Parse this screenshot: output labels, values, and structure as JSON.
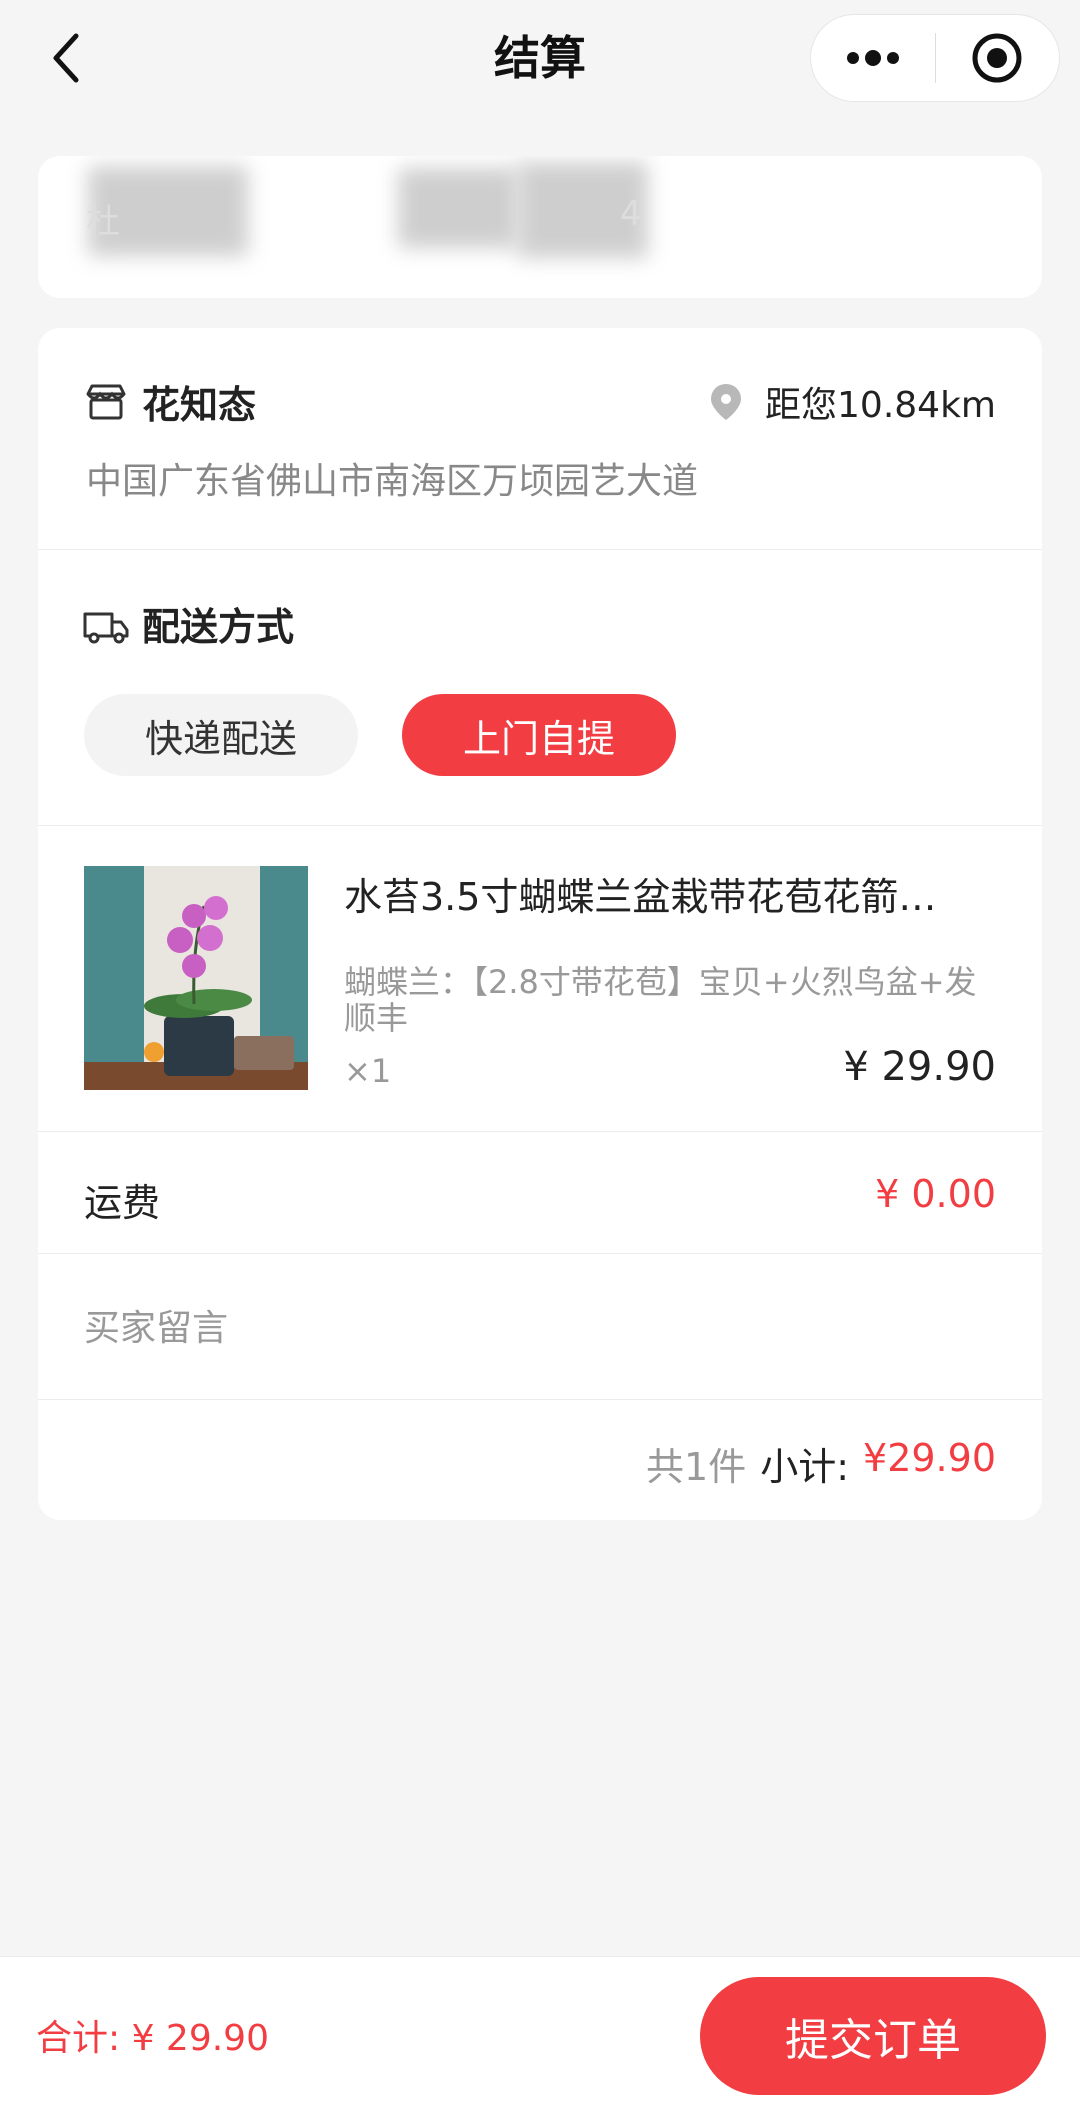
{
  "navbar": {
    "title": "结算",
    "back_icon": "chevron-left-icon",
    "menu_icon": "more-dots-icon",
    "target_icon": "circle-target-icon"
  },
  "address": {
    "name_partial": "杜",
    "phone_partial": "4"
  },
  "store": {
    "name": "花知态",
    "distance": "距您10.84km",
    "address": "中国广东省佛山市南海区万顷园艺大道",
    "icon": "store-icon",
    "location_icon": "location-pin-icon"
  },
  "delivery": {
    "title": "配送方式",
    "icon": "truck-icon",
    "options": [
      "快递配送",
      "上门自提"
    ],
    "selected": "上门自提"
  },
  "product": {
    "name": "水苔3.5寸蝴蝶兰盆栽带花苞花箭…",
    "spec": "蝴蝶兰：【2.8寸带花苞】宝贝+火烈鸟盆+发顺丰",
    "qty": "×1",
    "price": "¥ 29.90"
  },
  "shipping": {
    "label": "运费",
    "value": "¥ 0.00"
  },
  "message": {
    "placeholder": "买家留言"
  },
  "subtotal": {
    "count": "共1件",
    "label": "小计:",
    "value": "¥29.90"
  },
  "bottom": {
    "total": "合计: ¥ 29.90",
    "submit": "提交订单"
  },
  "colors": {
    "accent": "#f23d42",
    "background": "#f5f5f5"
  }
}
